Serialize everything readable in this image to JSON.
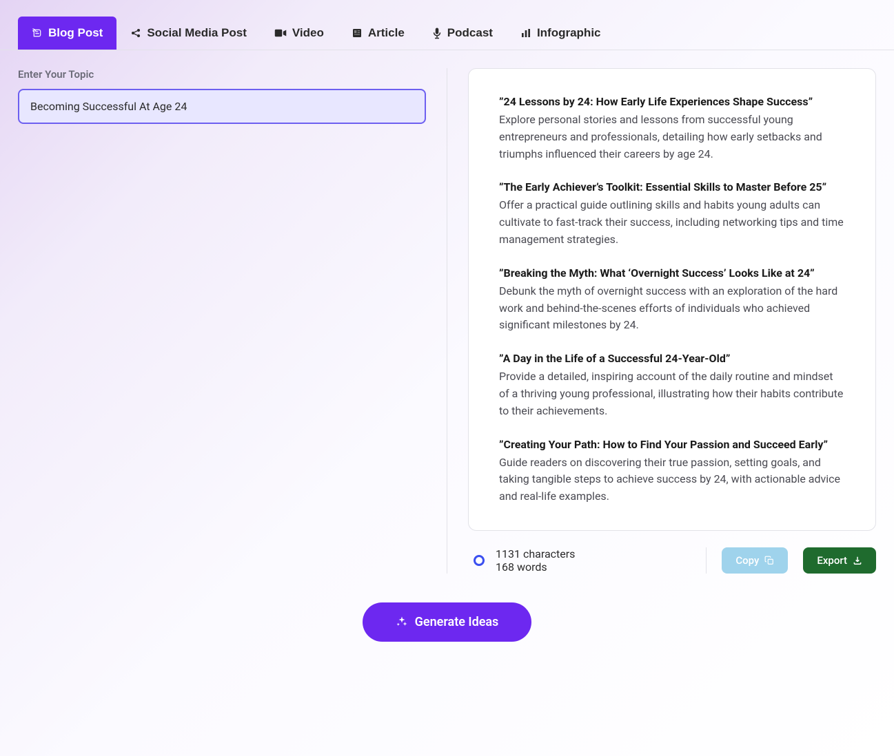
{
  "tabs": [
    {
      "label": "Blog Post",
      "icon": "blog-icon",
      "active": true
    },
    {
      "label": "Social Media Post",
      "icon": "share-icon",
      "active": false
    },
    {
      "label": "Video",
      "icon": "video-icon",
      "active": false
    },
    {
      "label": "Article",
      "icon": "article-icon",
      "active": false
    },
    {
      "label": "Podcast",
      "icon": "mic-icon",
      "active": false
    },
    {
      "label": "Infographic",
      "icon": "chart-icon",
      "active": false
    }
  ],
  "form": {
    "topic_label": "Enter Your Topic",
    "topic_value": "Becoming Successful At Age 24"
  },
  "ideas": [
    {
      "title": "”24 Lessons by 24: How Early Life Experiences Shape Success”",
      "desc": "Explore personal stories and lessons from successful young entrepreneurs and professionals, detailing how early setbacks and triumphs influenced their careers by age 24."
    },
    {
      "title": "”The Early Achiever’s Toolkit: Essential Skills to Master Before 25”",
      "desc": "Offer a practical guide outlining skills and habits young adults can cultivate to fast-track their success, including networking tips and time management strategies."
    },
    {
      "title": "”Breaking the Myth: What ‘Overnight Success’ Looks Like at 24”",
      "desc": "Debunk the myth of overnight success with an exploration of the hard work and behind-the-scenes efforts of individuals who achieved significant milestones by 24."
    },
    {
      "title": "”A Day in the Life of a Successful 24-Year-Old”",
      "desc": "Provide a detailed, inspiring account of the daily routine and mindset of a thriving young professional, illustrating how their habits contribute to their achievements."
    },
    {
      "title": "”Creating Your Path: How to Find Your Passion and Succeed Early”",
      "desc": "Guide readers on discovering their true passion, setting goals, and taking tangible steps to achieve success by 24, with actionable advice and real-life examples."
    }
  ],
  "stats": {
    "characters": "1131 characters",
    "words": "168 words"
  },
  "actions": {
    "copy_label": "Copy",
    "export_label": "Export",
    "generate_label": "Generate Ideas"
  }
}
